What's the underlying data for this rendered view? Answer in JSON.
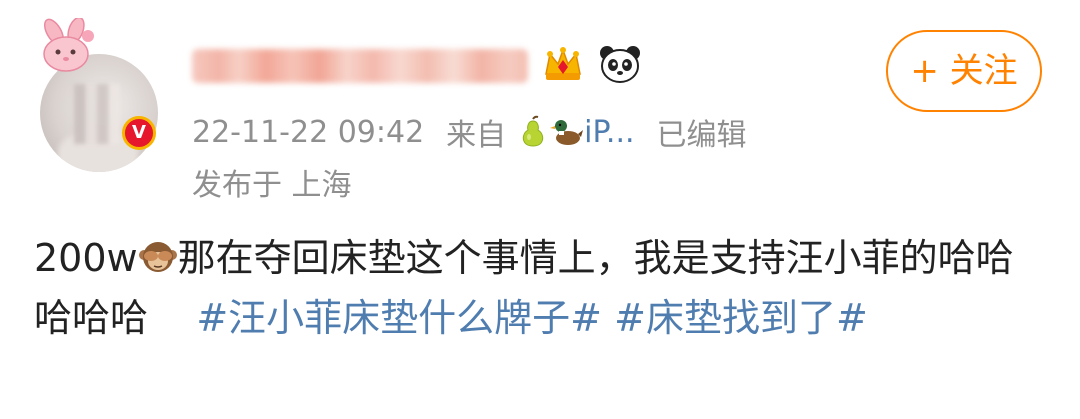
{
  "post": {
    "author": {
      "name_obscured": true,
      "verified": true,
      "verified_badge_text": "V",
      "badges": [
        "crown-icon",
        "panda-icon"
      ]
    },
    "follow_button_label": "+ 关注",
    "timestamp": "22-11-22 09:42",
    "source_prefix": "来自",
    "source_device": "iP...",
    "edited_label": "已编辑",
    "location": "发布于 上海",
    "body": {
      "text_prefix": "200w",
      "text_main": "那在夺回床垫这个事情上，我是支持汪小菲的哈哈哈哈哈",
      "hashtags": [
        "#汪小菲床垫什么牌子#",
        "#床垫找到了#"
      ]
    },
    "colors": {
      "accent_orange": "#ff8200",
      "link_blue": "#507daf",
      "meta_gray": "#8f8f8f",
      "text": "#222222",
      "verified_red": "#e6162d"
    },
    "icons": {
      "avatar_decoration": "pink-bunny-icon",
      "source_icons": [
        "pear-icon",
        "duck-icon"
      ],
      "body_emoji": "monkey-see-no-evil-icon"
    }
  }
}
